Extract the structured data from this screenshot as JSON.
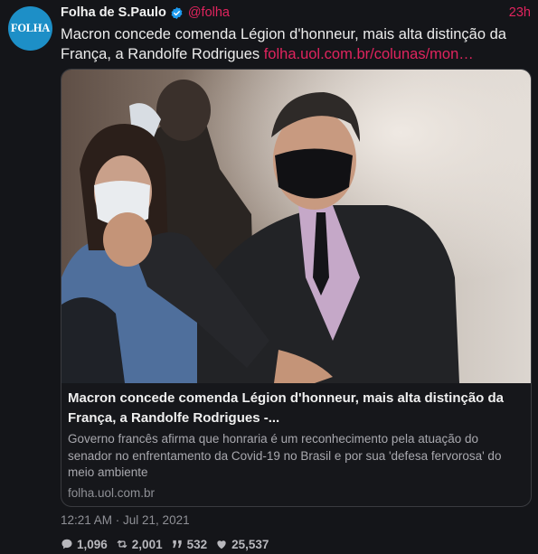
{
  "account": {
    "avatar_text": "FOLHA",
    "name": "Folha de S.Paulo",
    "handle": "@folha",
    "time": "23h",
    "verified_icon": "verified-badge-icon"
  },
  "tweet": {
    "text": "Macron concede comenda Légion d'honneur, mais alta distinção da França, a Randolfe Rodrigues",
    "link": "folha.uol.com.br/colunas/mon…"
  },
  "card": {
    "title": "Macron concede comenda Légion d'honneur, mais alta distinção da França, a Randolfe Rodrigues -...",
    "description": "Governo francês afirma que honraria é um reconhecimento pela atuação do senador no enfrentamento da Covid-19 no Brasil e por sua 'defesa fervorosa' do meio ambiente",
    "domain": "folha.uol.com.br"
  },
  "meta": {
    "timestamp": "12:21 AM · Jul 21, 2021"
  },
  "stats": {
    "replies": "1,096",
    "retweets": "2,001",
    "quotes": "532",
    "likes": "25,537"
  },
  "colors": {
    "background": "#141519",
    "accent": "#e0245e",
    "avatar": "#1d8fc7"
  }
}
